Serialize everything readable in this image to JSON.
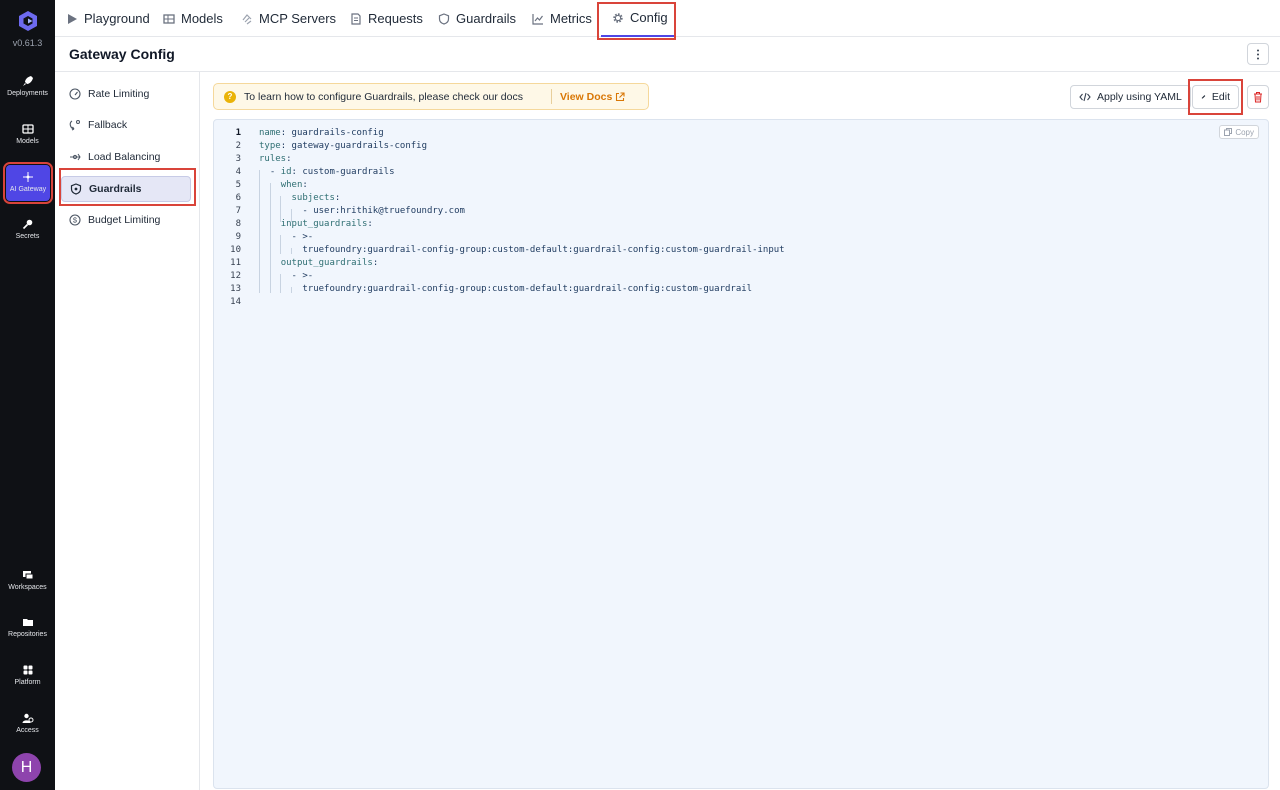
{
  "app": {
    "version": "v0.61.3",
    "user_initial": "H"
  },
  "rail": {
    "items": [
      {
        "label": "Deployments",
        "icon": "rocket-icon"
      },
      {
        "label": "Models",
        "icon": "grid-icon"
      },
      {
        "label": "AI Gateway",
        "icon": "gateway-icon"
      },
      {
        "label": "Secrets",
        "icon": "key-icon"
      },
      {
        "label": "Workspaces",
        "icon": "workspaces-icon"
      },
      {
        "label": "Repositories",
        "icon": "folder-icon"
      },
      {
        "label": "Platform",
        "icon": "apps-icon"
      },
      {
        "label": "Access",
        "icon": "users-icon"
      }
    ]
  },
  "tabs": [
    {
      "label": "Playground",
      "icon": "play-icon"
    },
    {
      "label": "Models",
      "icon": "table-icon"
    },
    {
      "label": "MCP Servers",
      "icon": "mcp-icon"
    },
    {
      "label": "Requests",
      "icon": "document-icon"
    },
    {
      "label": "Guardrails",
      "icon": "shield-icon"
    },
    {
      "label": "Metrics",
      "icon": "chart-icon"
    },
    {
      "label": "Config",
      "icon": "gear-icon"
    }
  ],
  "header": {
    "title": "Gateway Config"
  },
  "subnav": [
    {
      "label": "Rate Limiting",
      "icon": "gauge-icon"
    },
    {
      "label": "Fallback",
      "icon": "fallback-icon"
    },
    {
      "label": "Load Balancing",
      "icon": "balance-icon"
    },
    {
      "label": "Guardrails",
      "icon": "shield-icon"
    },
    {
      "label": "Budget Limiting",
      "icon": "dollar-icon"
    }
  ],
  "banner": {
    "text": "To learn how to configure Guardrails, please check our docs",
    "link": "View Docs"
  },
  "toolbar": {
    "apply_label": "Apply using YAML",
    "edit_label": "Edit"
  },
  "editor": {
    "copy_label": "Copy",
    "lines": [
      {
        "n": "1",
        "key": "name",
        "val": " guardrails-config",
        "indent": ""
      },
      {
        "n": "2",
        "key": "type",
        "val": " gateway-guardrails-config",
        "indent": ""
      },
      {
        "n": "3",
        "key": "rules",
        "val": "",
        "indent": ""
      },
      {
        "n": "4",
        "key": "id",
        "val": " custom-guardrails",
        "indent": "  - "
      },
      {
        "n": "5",
        "key": "when",
        "val": "",
        "indent": "    "
      },
      {
        "n": "6",
        "key": "subjects",
        "val": "",
        "indent": "      "
      },
      {
        "n": "7",
        "key": "",
        "val": "user:hrithik@truefoundry.com",
        "indent": "        - "
      },
      {
        "n": "8",
        "key": "input_guardrails",
        "val": "",
        "indent": "    "
      },
      {
        "n": "9",
        "key": "",
        "val": ">-",
        "indent": "      - "
      },
      {
        "n": "10",
        "key": "",
        "val": "truefoundry:guardrail-config-group:custom-default:guardrail-config:custom-guardrail-input",
        "indent": "        "
      },
      {
        "n": "11",
        "key": "output_guardrails",
        "val": "",
        "indent": "    "
      },
      {
        "n": "12",
        "key": "",
        "val": ">-",
        "indent": "      - "
      },
      {
        "n": "13",
        "key": "",
        "val": "truefoundry:guardrail-config-group:custom-default:guardrail-config:custom-guardrail",
        "indent": "        "
      },
      {
        "n": "14",
        "key": "",
        "val": "",
        "indent": ""
      }
    ]
  }
}
